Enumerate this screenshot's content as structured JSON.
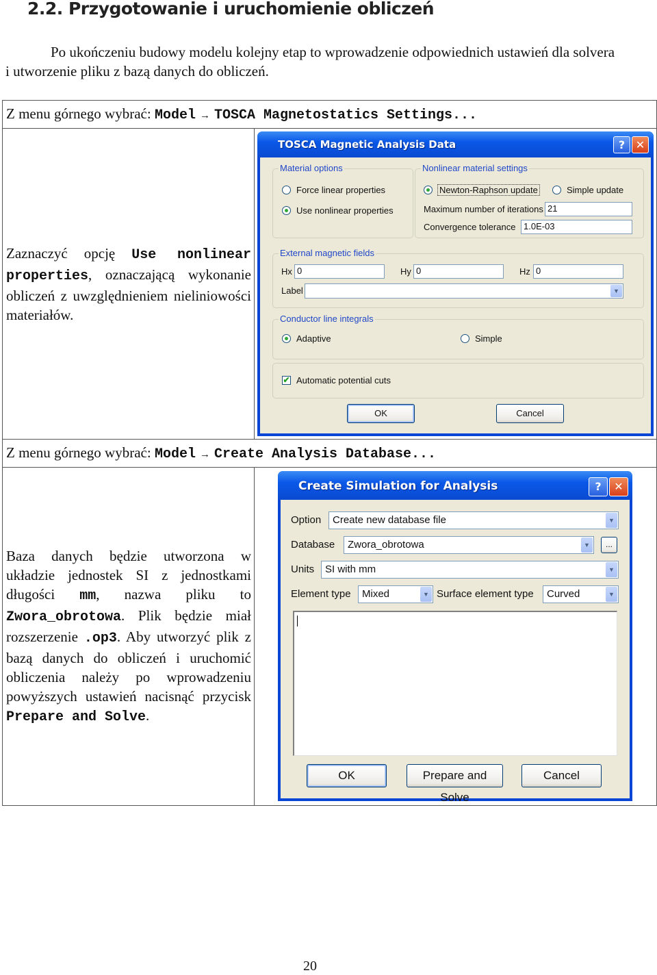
{
  "heading": "2.2.  Przygotowanie i uruchomienie obliczeń",
  "intro": "Po ukończeniu budowy modelu kolejny etap to wprowadzenie odpowiednich ustawień dla solvera i utworzenie pliku z bazą danych do obliczeń.",
  "step1": {
    "menu_prefix": "Z menu górnego wybrać:",
    "menu_model": "Model",
    "arrow": "→",
    "menu_item": "TOSCA Magnetostatics Settings...",
    "desc_a": "Zaznaczyć opcję",
    "desc_code": "Use nonlinear properties",
    "desc_b": ", oznaczającą wykonanie obliczeń z uwzględnieniem nieliniowości materiałów.",
    "dialog": {
      "title": "TOSCA Magnetic Analysis Data",
      "help": "?",
      "close": "✕",
      "material_options": {
        "label": "Material options",
        "force_linear": "Force linear properties",
        "use_nonlinear": "Use nonlinear properties",
        "selected": "use_nonlinear"
      },
      "nonlinear_settings": {
        "label": "Nonlinear material settings",
        "newton": "Newton-Raphson update",
        "simple": "Simple update",
        "selected": "newton",
        "max_iter_label": "Maximum number of iterations",
        "max_iter_value": "21",
        "tolerance_label": "Convergence tolerance",
        "tolerance_value": "1.0E-03"
      },
      "external_fields": {
        "label": "External magnetic fields",
        "hx_label": "Hx",
        "hx_value": "0",
        "hy_label": "Hy",
        "hy_value": "0",
        "hz_label": "Hz",
        "hz_value": "0",
        "label_field_label": "Label",
        "label_field_value": ""
      },
      "conductor_integrals": {
        "label": "Conductor line integrals",
        "adaptive": "Adaptive",
        "simple": "Simple",
        "selected": "adaptive"
      },
      "auto_cuts": {
        "label": "Automatic potential cuts",
        "checked": true,
        "check_glyph": "✔"
      },
      "ok": "OK",
      "cancel": "Cancel"
    }
  },
  "step2": {
    "menu_prefix": "Z menu górnego wybrać:",
    "menu_model": "Model",
    "arrow": "→",
    "menu_item": "Create Analysis Database...",
    "desc": {
      "p1": "Baza danych będzie utworzona w układzie jednostek SI z jednostkami długości",
      "c1": "mm",
      "p2": ", nazwa pliku to",
      "c2": "Zwora_obrotowa",
      "p3": ". Plik będzie miał rozszerzenie",
      "c3": ".op3",
      "p4": ". Aby utworzyć plik z bazą danych do obliczeń i uruchomić obliczenia należy po wprowadzeniu powyższych ustawień nacisnąć przycisk",
      "c4": "Prepare and Solve",
      "p5": "."
    },
    "dialog": {
      "title": "Create Simulation for Analysis",
      "help": "?",
      "close": "✕",
      "option_label": "Option",
      "option_value": "Create new database file",
      "database_label": "Database",
      "database_value": "Zwora_obrotowa",
      "browse": "...",
      "units_label": "Units",
      "units_value": "SI with mm",
      "element_type_label": "Element type",
      "element_type_value": "Mixed",
      "surface_type_label": "Surface element type",
      "surface_type_value": "Curved",
      "notes_value": "",
      "ok": "OK",
      "prepare": "Prepare and Solve",
      "cancel": "Cancel",
      "dropdown_glyph": "▼"
    }
  },
  "page_number": "20"
}
